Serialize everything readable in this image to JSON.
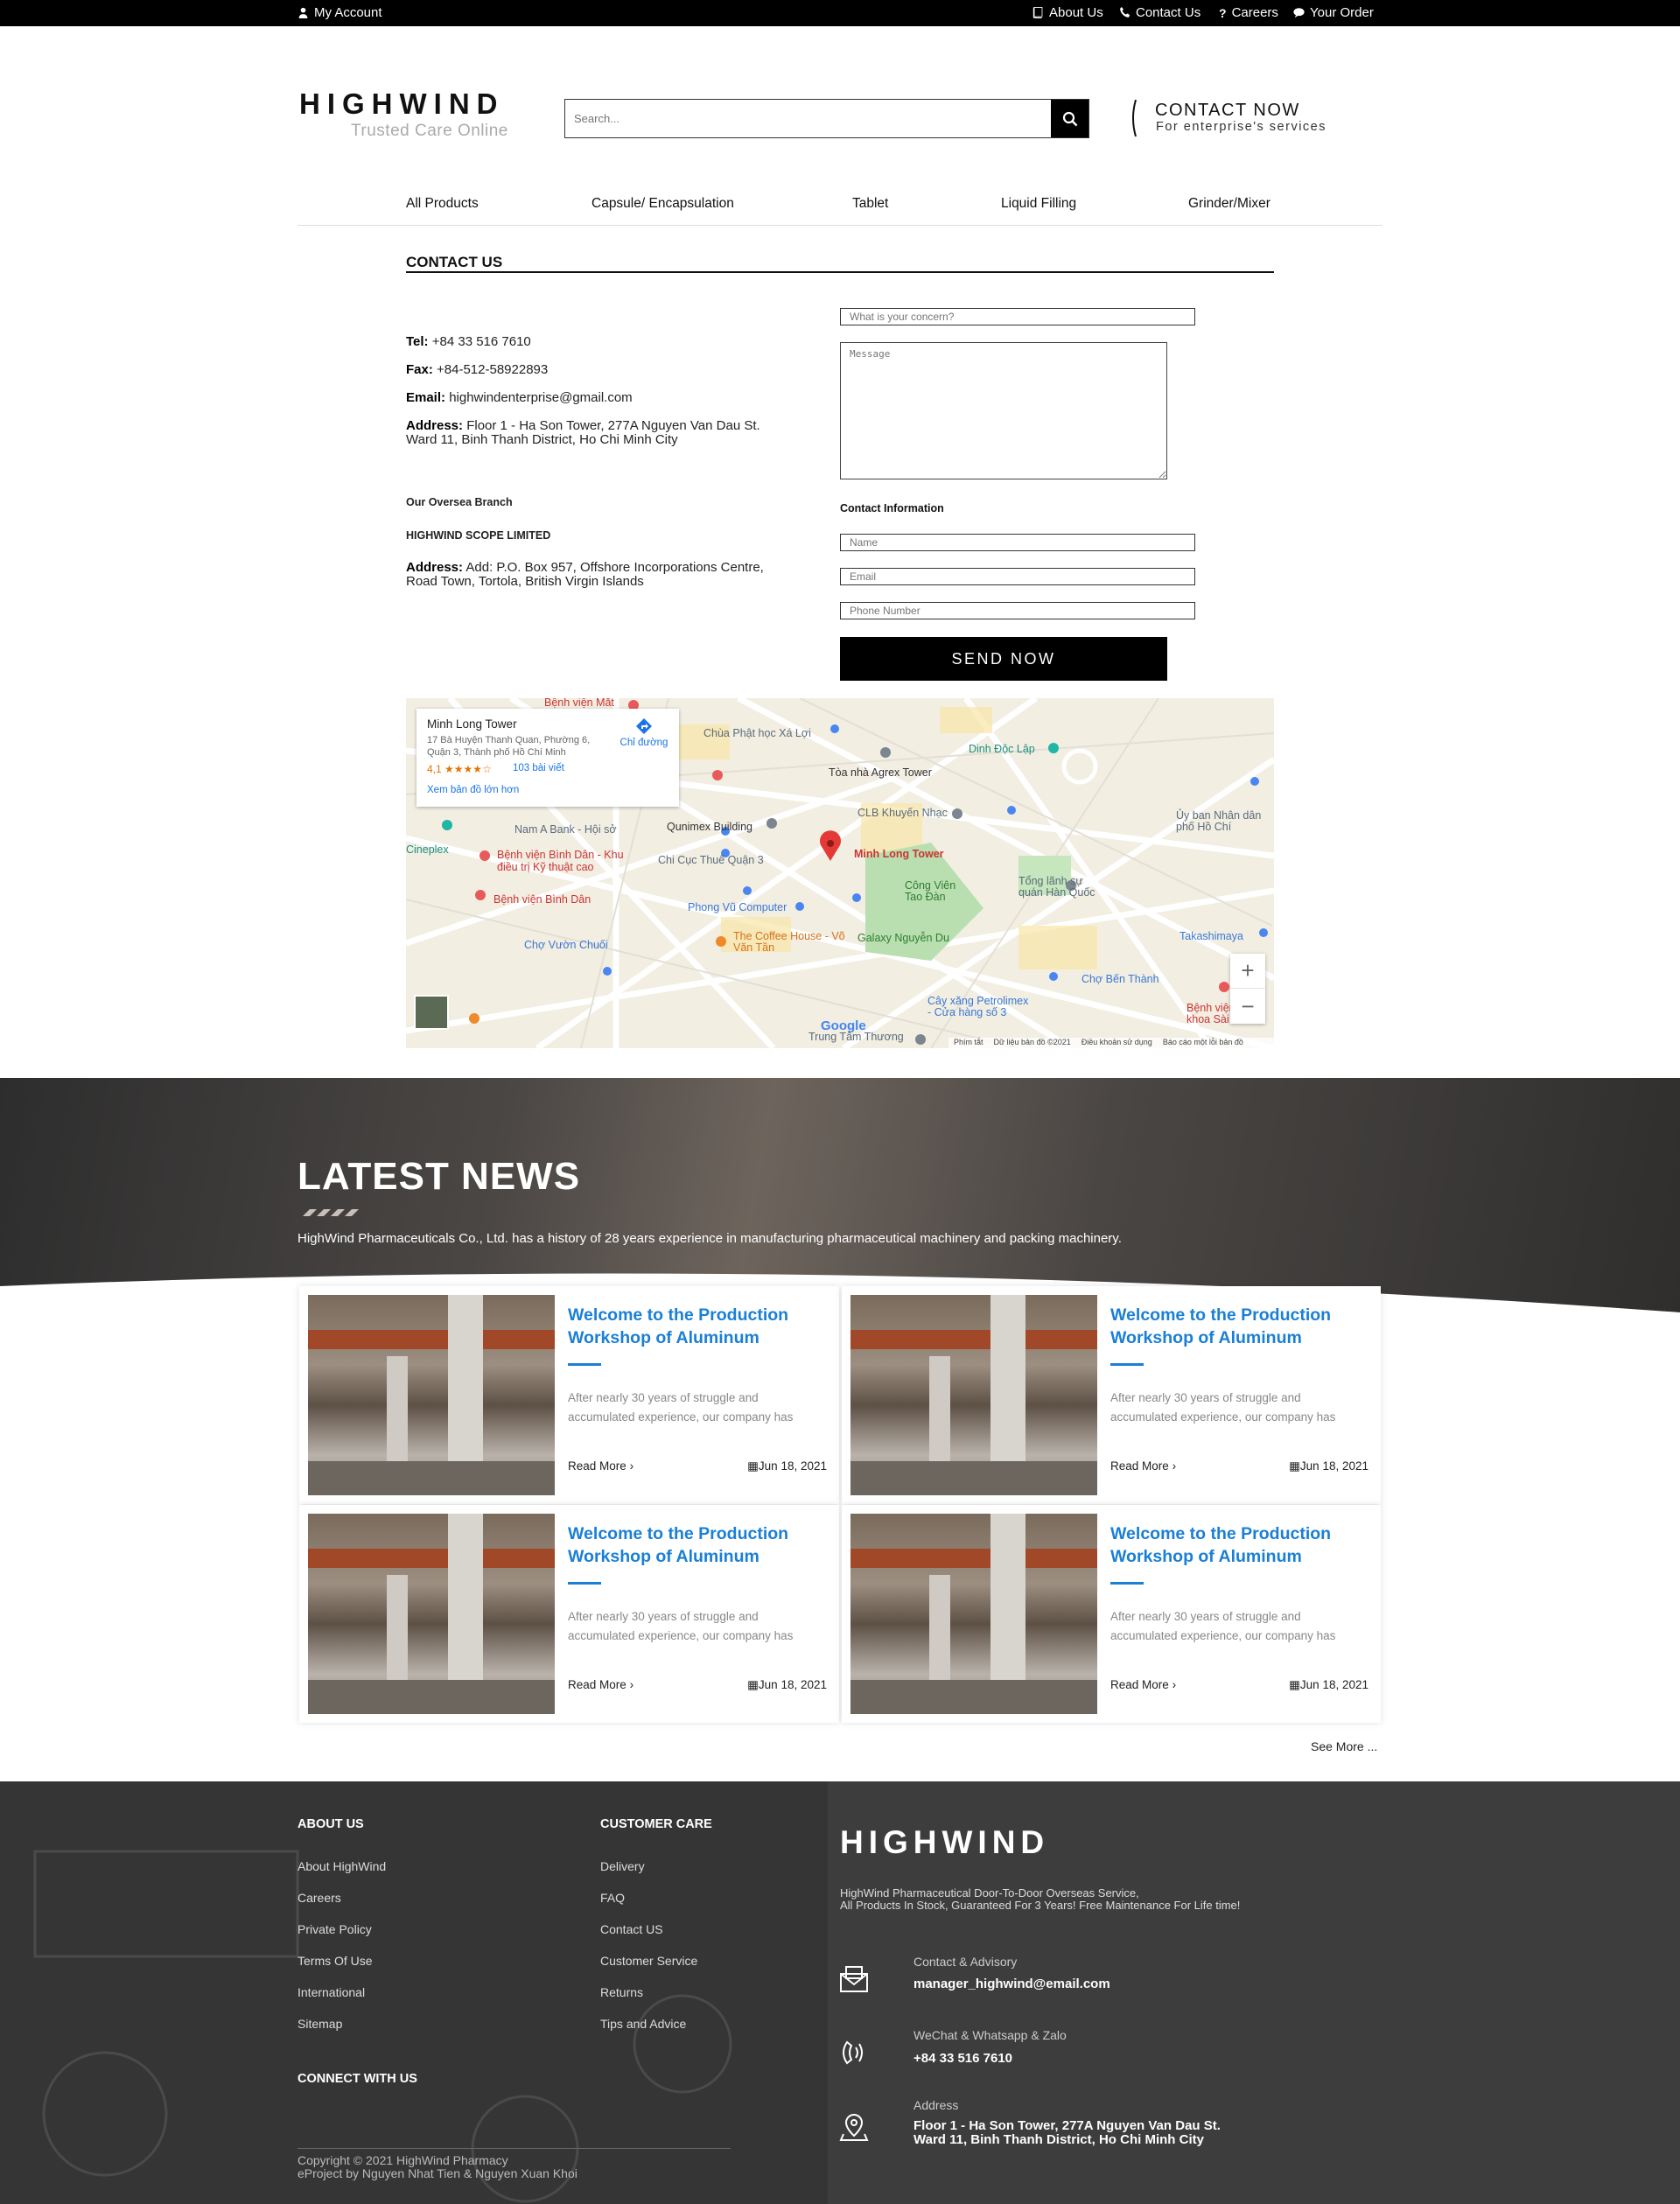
{
  "topbar": {
    "my_account": "My Account",
    "about_us": "About Us",
    "contact_us": "Contact Us",
    "careers": "Careers",
    "your_order": "Your Order"
  },
  "header": {
    "logo": "HIGHWIND",
    "tagline": "Trusted Care Online",
    "search_placeholder": "Search...",
    "contact_now": "CONTACT NOW",
    "contact_now_sub": "For enterprise's services"
  },
  "nav": {
    "items": [
      "All Products",
      "Capsule/ Encapsulation",
      "Tablet",
      "Liquid Filling",
      "Grinder/Mixer"
    ]
  },
  "contact": {
    "title": "CONTACT US",
    "tel_label": "Tel:",
    "tel": "+84 33 516 7610",
    "fax_label": "Fax:",
    "fax": "+84-512-58922893",
    "email_label": "Email:",
    "email": "highwindenterprise@gmail.com",
    "address_label": "Address:",
    "address_line1": "Floor 1 - Ha Son Tower, 277A Nguyen Van Dau St.",
    "address_line2": "Ward 11, Binh Thanh District, Ho Chi Minh City",
    "oversea_branch": "Our Oversea Branch",
    "company": "HIGHWIND SCOPE LIMITED",
    "oversea_address_label": "Address:",
    "oversea_address_line1": "Add: P.O. Box 957, Offshore Incorporations Centre,",
    "oversea_address_line2": "Road Town, Tortola, British Virgin Islands"
  },
  "form": {
    "concern_placeholder": "What is your concern?",
    "message_placeholder": "Message",
    "contact_info_label": "Contact Information",
    "name_placeholder": "Name",
    "email_placeholder": "Email",
    "phone_placeholder": "Phone Number",
    "send_label": "SEND NOW"
  },
  "map": {
    "place_name": "Minh Long Tower",
    "place_address_1": "17 Bà Huyện Thanh Quan, Phường 6,",
    "place_address_2": "Quận 3, Thành phố Hồ Chí Minh",
    "rating": "4,1",
    "stars": "★★★★☆",
    "reviews": "103 bài viết",
    "bigger_map": "Xem bản đồ lớn hơn",
    "directions": "Chỉ đường",
    "pin_label": "Minh Long Tower",
    "labels": [
      "Chùa Phật học Xá Lợi",
      "Dinh Độc Lập",
      "Tòa nhà Agrex Tower",
      "CLB Khuyến Nhạc",
      "Qunimex Building",
      "Nam A Bank - Hội sở",
      "Chi Cục Thuế Quận 3",
      "Bệnh viện Bình Dân - Khu điều trị Kỹ thuật cao",
      "Bệnh viện Bình Dân",
      "Phong Vũ Computer",
      "Công Viên Tao Đàn",
      "Tổng lãnh sự quán Hàn Quốc",
      "The Coffee House - Võ Văn Tần",
      "Galaxy Nguyễn Du",
      "Chợ Vườn Chuối",
      "Chợ Bến Thành",
      "Takashimaya",
      "Ủy ban Nhân dân phố Hồ Chí",
      "Cây xăng Petrolimex - Cửa hàng số 3",
      "Trung Tâm Thương",
      "Bệnh viện Mắt",
      "Cineplex",
      "Bệnh viện khoa Sài"
    ],
    "zoom_in": "+",
    "zoom_out": "−",
    "footer_items": [
      "Phím tắt",
      "Dữ liệu bản đồ ©2021",
      "Điều khoản sử dụng",
      "Báo cáo một lỗi bản đồ"
    ],
    "google": "Google"
  },
  "news": {
    "title": "LATEST NEWS",
    "subtitle": "HighWind Pharmaceuticals Co., Ltd. has a history of 28 years experience in manufacturing pharmaceutical machinery and packing machinery.",
    "cards": [
      {
        "title": "Welcome to the Production Workshop of Aluminum",
        "excerpt": "After nearly 30 years of struggle and accumulated experience, our company has",
        "read_more": "Read More",
        "date": "Jun 18, 2021"
      },
      {
        "title": "Welcome to the Production Workshop of Aluminum",
        "excerpt": "After nearly 30 years of struggle and accumulated experience, our company has",
        "read_more": "Read More",
        "date": "Jun 18, 2021"
      },
      {
        "title": "Welcome to the Production Workshop of Aluminum",
        "excerpt": "After nearly 30 years of struggle and accumulated experience, our company has",
        "read_more": "Read More",
        "date": "Jun 18, 2021"
      },
      {
        "title": "Welcome to the Production Workshop of Aluminum",
        "excerpt": "After nearly 30 years of struggle and accumulated experience, our company has",
        "read_more": "Read More",
        "date": "Jun 18, 2021"
      }
    ],
    "see_more": "See More ..."
  },
  "footer": {
    "about_title": "ABOUT US",
    "about_links": [
      "About HighWind",
      "Careers",
      "Private Policy",
      "Terms Of Use",
      "International",
      "Sitemap"
    ],
    "care_title": "CUSTOMER CARE",
    "care_links": [
      "Delivery",
      "FAQ",
      "Contact US",
      "Customer Service",
      "Returns",
      "Tips and Advice"
    ],
    "connect_title": "CONNECT WITH US",
    "logo": "HIGHWIND",
    "desc_line1": "HighWind Pharmaceutical Door-To-Door Overseas Service,",
    "desc_line2": "All Products In Stock, Guaranteed For 3 Years! Free Maintenance For Life time!",
    "advisory_label": "Contact & Advisory",
    "advisory_value": "manager_highwind@email.com",
    "wechat_label": "WeChat & Whatsapp & Zalo",
    "wechat_value": "+84 33 516 7610",
    "address_label": "Address",
    "address_line1": "Floor 1 - Ha Son Tower, 277A Nguyen Van Dau St.",
    "address_line2": "Ward 11, Binh Thanh District, Ho Chi Minh City",
    "copyright": "Copyright © 2021 HighWind Pharmacy",
    "credit": "eProject by Nguyen Nhat Tien & Nguyen Xuan Khoi"
  }
}
